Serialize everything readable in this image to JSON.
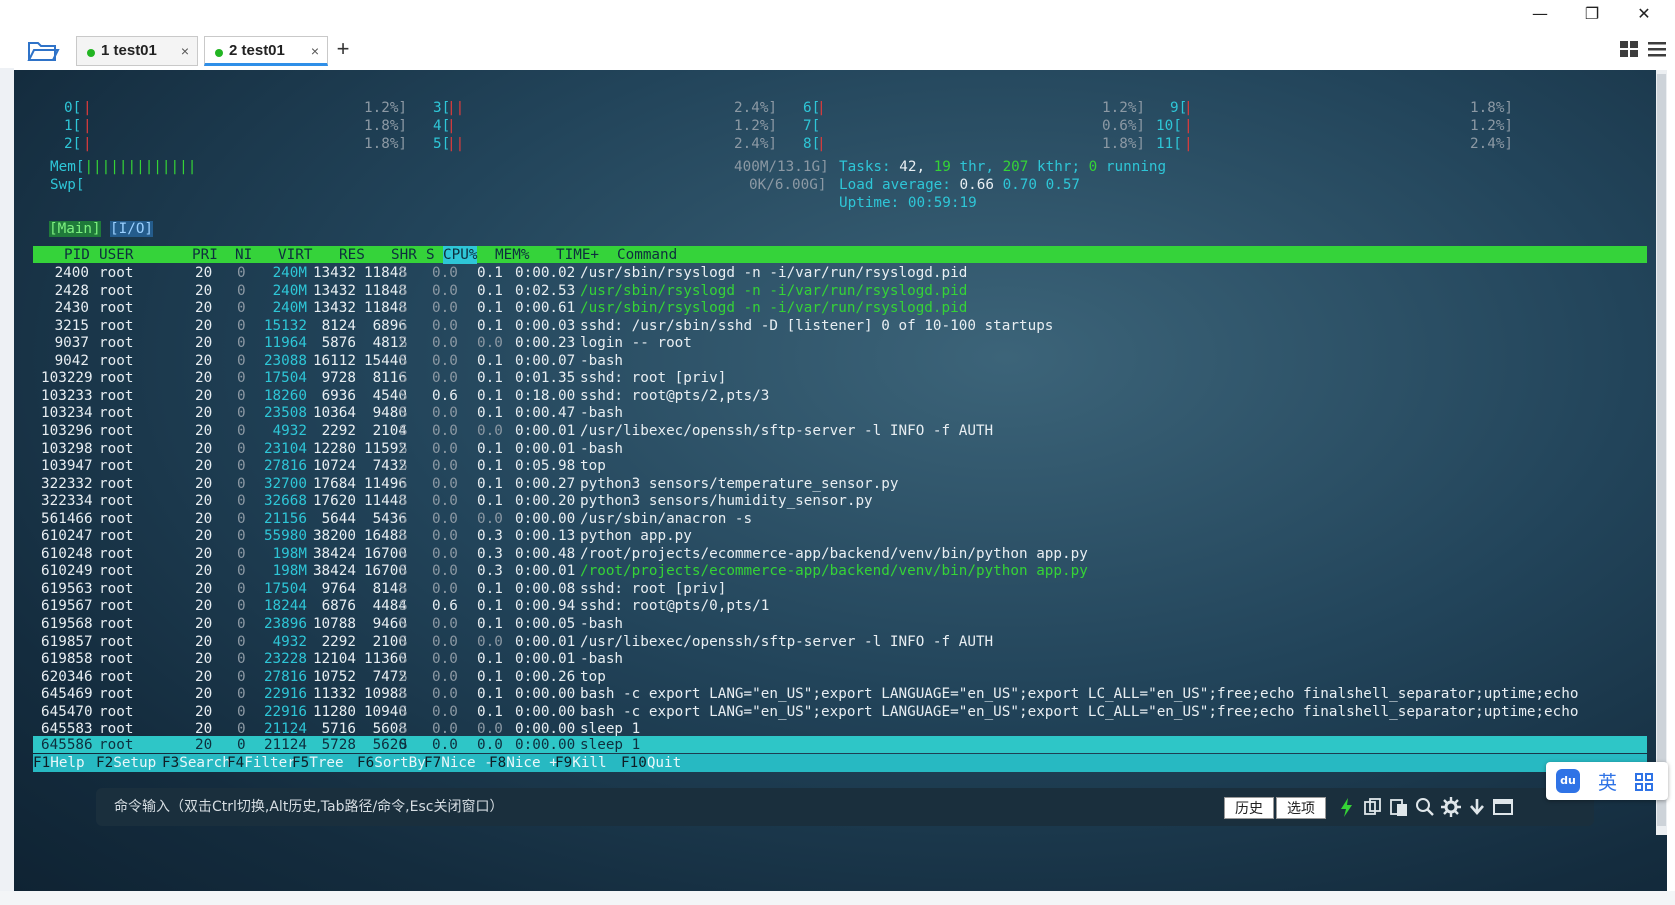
{
  "window": {
    "minimize": "—",
    "restore": "❐",
    "close": "✕"
  },
  "tabs": [
    {
      "label": "1 test01",
      "close": "×",
      "active": false
    },
    {
      "label": "2 test01",
      "close": "×",
      "active": true
    }
  ],
  "add_tab": "+",
  "meters": {
    "cpu": [
      {
        "id": "0[",
        "bar": "|",
        "pct": "1.2%]"
      },
      {
        "id": "1[",
        "bar": "|",
        "pct": "1.8%]"
      },
      {
        "id": "2[",
        "bar": "|",
        "pct": "1.8%]"
      },
      {
        "id": "3[",
        "bar": "||",
        "pct": "2.4%]"
      },
      {
        "id": "4[",
        "bar": "|",
        "pct": "1.2%]"
      },
      {
        "id": "5[",
        "bar": "||",
        "pct": "2.4%]"
      },
      {
        "id": "6[",
        "bar": "|",
        "pct": "1.2%]"
      },
      {
        "id": "7[",
        "bar": "",
        "pct": "0.6%]"
      },
      {
        "id": "8[",
        "bar": "|",
        "pct": "1.8%]"
      },
      {
        "id": "9[",
        "bar": "|",
        "pct": "1.8%]"
      },
      {
        "id": "10[",
        "bar": "|",
        "pct": "1.2%]"
      },
      {
        "id": "11[",
        "bar": "|",
        "pct": "2.4%]"
      }
    ],
    "mem_label": "Mem[",
    "mem_bar": "|||||||||||||",
    "mem_value": "400M/13.1G]",
    "swp_label": "Swp[",
    "swp_value": "0K/6.00G]",
    "tasks_label": "Tasks:",
    "tasks_count": "42,",
    "threads": "19",
    "thr": "thr,",
    "kthreads": "207",
    "kthr": "kthr;",
    "running_count": "0",
    "running": "running",
    "load_label": "Load average:",
    "load1": "0.66",
    "load5": "0.70",
    "load15": "0.57",
    "uptime_label": "Uptime:",
    "uptime": "00:59:19"
  },
  "screen_tabs": {
    "main": "[Main]",
    "io": "[I/O]"
  },
  "columns": {
    "pid": "PID",
    "user": "USER",
    "pri": "PRI",
    "ni": "NI",
    "virt": "VIRT",
    "res": "RES",
    "shr": "SHR",
    "s": "S",
    "cpu": "CPU%",
    "mem": "MEM%",
    "time": "TIME+",
    "command": "Command"
  },
  "processes": [
    {
      "pid": "2400",
      "user": "root",
      "pri": "20",
      "ni": "0",
      "virt": "240M",
      "res": "13432",
      "shr": "11848",
      "s": "S",
      "cpu": "0.0",
      "mem": "0.1",
      "time": "0:00.02",
      "command": "/usr/sbin/rsyslogd -n -i/var/run/rsyslogd.pid",
      "thread": false
    },
    {
      "pid": "2428",
      "user": "root",
      "pri": "20",
      "ni": "0",
      "virt": "240M",
      "res": "13432",
      "shr": "11848",
      "s": "S",
      "cpu": "0.0",
      "mem": "0.1",
      "time": "0:02.53",
      "command": "/usr/sbin/rsyslogd -n -i/var/run/rsyslogd.pid",
      "thread": true
    },
    {
      "pid": "2430",
      "user": "root",
      "pri": "20",
      "ni": "0",
      "virt": "240M",
      "res": "13432",
      "shr": "11848",
      "s": "S",
      "cpu": "0.0",
      "mem": "0.1",
      "time": "0:00.61",
      "command": "/usr/sbin/rsyslogd -n -i/var/run/rsyslogd.pid",
      "thread": true
    },
    {
      "pid": "3215",
      "user": "root",
      "pri": "20",
      "ni": "0",
      "virt": "15132",
      "res": "8124",
      "shr": "6896",
      "s": "S",
      "cpu": "0.0",
      "mem": "0.1",
      "time": "0:00.03",
      "command": "sshd: /usr/sbin/sshd -D [listener] 0 of 10-100 startups",
      "thread": false
    },
    {
      "pid": "9037",
      "user": "root",
      "pri": "20",
      "ni": "0",
      "virt": "11964",
      "res": "5876",
      "shr": "4812",
      "s": "S",
      "cpu": "0.0",
      "mem": "0.0",
      "time": "0:00.23",
      "command": "login -- root",
      "thread": false
    },
    {
      "pid": "9042",
      "user": "root",
      "pri": "20",
      "ni": "0",
      "virt": "23088",
      "res": "16112",
      "shr": "15440",
      "s": "S",
      "cpu": "0.0",
      "mem": "0.1",
      "time": "0:00.07",
      "command": "-bash",
      "thread": false
    },
    {
      "pid": "103229",
      "user": "root",
      "pri": "20",
      "ni": "0",
      "virt": "17504",
      "res": "9728",
      "shr": "8116",
      "s": "S",
      "cpu": "0.0",
      "mem": "0.1",
      "time": "0:01.35",
      "command": "sshd: root [priv]",
      "thread": false
    },
    {
      "pid": "103233",
      "user": "root",
      "pri": "20",
      "ni": "0",
      "virt": "18260",
      "res": "6936",
      "shr": "4540",
      "s": "S",
      "cpu": "0.6",
      "mem": "0.1",
      "time": "0:18.00",
      "command": "sshd: root@pts/2,pts/3",
      "thread": false
    },
    {
      "pid": "103234",
      "user": "root",
      "pri": "20",
      "ni": "0",
      "virt": "23508",
      "res": "10364",
      "shr": "9480",
      "s": "S",
      "cpu": "0.0",
      "mem": "0.1",
      "time": "0:00.47",
      "command": "-bash",
      "thread": false
    },
    {
      "pid": "103296",
      "user": "root",
      "pri": "20",
      "ni": "0",
      "virt": "4932",
      "res": "2292",
      "shr": "2104",
      "s": "S",
      "cpu": "0.0",
      "mem": "0.0",
      "time": "0:00.01",
      "command": "/usr/libexec/openssh/sftp-server -l INFO -f AUTH",
      "thread": false
    },
    {
      "pid": "103298",
      "user": "root",
      "pri": "20",
      "ni": "0",
      "virt": "23104",
      "res": "12280",
      "shr": "11592",
      "s": "S",
      "cpu": "0.0",
      "mem": "0.1",
      "time": "0:00.01",
      "command": "-bash",
      "thread": false
    },
    {
      "pid": "103947",
      "user": "root",
      "pri": "20",
      "ni": "0",
      "virt": "27816",
      "res": "10724",
      "shr": "7432",
      "s": "S",
      "cpu": "0.0",
      "mem": "0.1",
      "time": "0:05.98",
      "command": "top",
      "thread": false
    },
    {
      "pid": "322332",
      "user": "root",
      "pri": "20",
      "ni": "0",
      "virt": "32700",
      "res": "17684",
      "shr": "11496",
      "s": "S",
      "cpu": "0.0",
      "mem": "0.1",
      "time": "0:00.27",
      "command": "python3 sensors/temperature_sensor.py",
      "thread": false
    },
    {
      "pid": "322334",
      "user": "root",
      "pri": "20",
      "ni": "0",
      "virt": "32668",
      "res": "17620",
      "shr": "11448",
      "s": "S",
      "cpu": "0.0",
      "mem": "0.1",
      "time": "0:00.20",
      "command": "python3 sensors/humidity_sensor.py",
      "thread": false
    },
    {
      "pid": "561466",
      "user": "root",
      "pri": "20",
      "ni": "0",
      "virt": "21156",
      "res": "5644",
      "shr": "5436",
      "s": "S",
      "cpu": "0.0",
      "mem": "0.0",
      "time": "0:00.00",
      "command": "/usr/sbin/anacron -s",
      "thread": false
    },
    {
      "pid": "610247",
      "user": "root",
      "pri": "20",
      "ni": "0",
      "virt": "55980",
      "res": "38200",
      "shr": "16488",
      "s": "S",
      "cpu": "0.0",
      "mem": "0.3",
      "time": "0:00.13",
      "command": "python app.py",
      "thread": false
    },
    {
      "pid": "610248",
      "user": "root",
      "pri": "20",
      "ni": "0",
      "virt": "198M",
      "res": "38424",
      "shr": "16700",
      "s": "S",
      "cpu": "0.0",
      "mem": "0.3",
      "time": "0:00.48",
      "command": "/root/projects/ecommerce-app/backend/venv/bin/python app.py",
      "thread": false
    },
    {
      "pid": "610249",
      "user": "root",
      "pri": "20",
      "ni": "0",
      "virt": "198M",
      "res": "38424",
      "shr": "16700",
      "s": "S",
      "cpu": "0.0",
      "mem": "0.3",
      "time": "0:00.01",
      "command": "/root/projects/ecommerce-app/backend/venv/bin/python app.py",
      "thread": true
    },
    {
      "pid": "619563",
      "user": "root",
      "pri": "20",
      "ni": "0",
      "virt": "17504",
      "res": "9764",
      "shr": "8148",
      "s": "S",
      "cpu": "0.0",
      "mem": "0.1",
      "time": "0:00.08",
      "command": "sshd: root [priv]",
      "thread": false
    },
    {
      "pid": "619567",
      "user": "root",
      "pri": "20",
      "ni": "0",
      "virt": "18244",
      "res": "6876",
      "shr": "4484",
      "s": "S",
      "cpu": "0.6",
      "mem": "0.1",
      "time": "0:00.94",
      "command": "sshd: root@pts/0,pts/1",
      "thread": false
    },
    {
      "pid": "619568",
      "user": "root",
      "pri": "20",
      "ni": "0",
      "virt": "23896",
      "res": "10788",
      "shr": "9460",
      "s": "S",
      "cpu": "0.0",
      "mem": "0.1",
      "time": "0:00.05",
      "command": "-bash",
      "thread": false
    },
    {
      "pid": "619857",
      "user": "root",
      "pri": "20",
      "ni": "0",
      "virt": "4932",
      "res": "2292",
      "shr": "2100",
      "s": "S",
      "cpu": "0.0",
      "mem": "0.0",
      "time": "0:00.01",
      "command": "/usr/libexec/openssh/sftp-server -l INFO -f AUTH",
      "thread": false
    },
    {
      "pid": "619858",
      "user": "root",
      "pri": "20",
      "ni": "0",
      "virt": "23228",
      "res": "12104",
      "shr": "11360",
      "s": "S",
      "cpu": "0.0",
      "mem": "0.1",
      "time": "0:00.01",
      "command": "-bash",
      "thread": false
    },
    {
      "pid": "620346",
      "user": "root",
      "pri": "20",
      "ni": "0",
      "virt": "27816",
      "res": "10752",
      "shr": "7472",
      "s": "S",
      "cpu": "0.0",
      "mem": "0.1",
      "time": "0:00.26",
      "command": "top",
      "thread": false
    },
    {
      "pid": "645469",
      "user": "root",
      "pri": "20",
      "ni": "0",
      "virt": "22916",
      "res": "11332",
      "shr": "10988",
      "s": "S",
      "cpu": "0.0",
      "mem": "0.1",
      "time": "0:00.00",
      "command": "bash -c export LANG=\"en_US\";export LANGUAGE=\"en_US\";export LC_ALL=\"en_US\";free;echo finalshell_separator;uptime;echo",
      "thread": false
    },
    {
      "pid": "645470",
      "user": "root",
      "pri": "20",
      "ni": "0",
      "virt": "22916",
      "res": "11280",
      "shr": "10940",
      "s": "S",
      "cpu": "0.0",
      "mem": "0.1",
      "time": "0:00.00",
      "command": "bash -c export LANG=\"en_US\";export LANGUAGE=\"en_US\";export LC_ALL=\"en_US\";free;echo finalshell_separator;uptime;echo",
      "thread": false
    },
    {
      "pid": "645583",
      "user": "root",
      "pri": "20",
      "ni": "0",
      "virt": "21124",
      "res": "5716",
      "shr": "5608",
      "s": "S",
      "cpu": "0.0",
      "mem": "0.0",
      "time": "0:00.00",
      "command": "sleep 1",
      "thread": false
    }
  ],
  "selected": {
    "pid": "645586",
    "user": "root",
    "pri": "20",
    "ni": "0",
    "virt": "21124",
    "res": "5728",
    "shr": "5620",
    "s": "S",
    "cpu": "0.0",
    "mem": "0.0",
    "time": "0:00.00",
    "command": "sleep 1"
  },
  "function_keys": [
    {
      "key": "F1",
      "label": "Help"
    },
    {
      "key": "F2",
      "label": "Setup"
    },
    {
      "key": "F3",
      "label": "Search"
    },
    {
      "key": "F4",
      "label": "Filter"
    },
    {
      "key": "F5",
      "label": "Tree"
    },
    {
      "key": "F6",
      "label": "SortBy"
    },
    {
      "key": "F7",
      "label": "Nice -"
    },
    {
      "key": "F8",
      "label": "Nice +"
    },
    {
      "key": "F9",
      "label": "Kill"
    },
    {
      "key": "F10",
      "label": "Quit"
    }
  ],
  "command_bar": {
    "hint": "命令输入（双击Ctrl切换,Alt历史,Tab路径/命令,Esc关闭窗口）",
    "history_button": "历史",
    "options_button": "选项"
  },
  "ime": {
    "logo": "du",
    "mode": "英"
  },
  "colors": {
    "header_bar": "#35d33a",
    "selected_row": "#2ec6c7",
    "terminal_bg": "#1b3a4d",
    "cpu_bar": "#e23b3b",
    "thread_text": "#35d336",
    "accent_cyan": "#2ec6d7"
  }
}
